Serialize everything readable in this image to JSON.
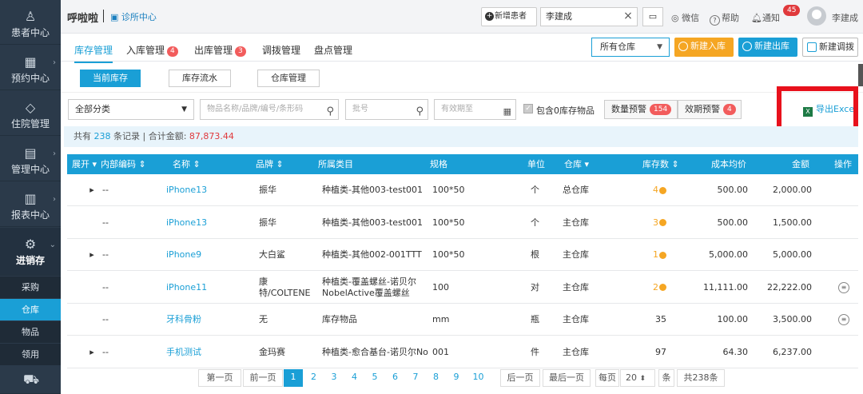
{
  "sidebar": {
    "items": [
      {
        "label": "患者中心",
        "icon": "person-icon"
      },
      {
        "label": "预约中心",
        "icon": "calendar-icon"
      },
      {
        "label": "住院管理",
        "icon": "tag-icon"
      },
      {
        "label": "管理中心",
        "icon": "book-icon"
      },
      {
        "label": "报表中心",
        "icon": "bar-chart-icon"
      },
      {
        "label": "进销存",
        "icon": "gear-icon"
      }
    ],
    "sub_items": [
      "采购",
      "仓库",
      "物品",
      "领用"
    ],
    "selected_sub": "仓库",
    "bottom_icon": "cart-icon"
  },
  "topbar": {
    "app_title": "呼啦啦",
    "clinic_link": "诊所中心",
    "new_patient": "新增患者",
    "patient_value": "李建成",
    "wechat": "微信",
    "help": "帮助",
    "notify": "通知",
    "notify_count": "45",
    "username": "李建成"
  },
  "tabs": [
    {
      "label": "库存管理",
      "badge": ""
    },
    {
      "label": "入库管理",
      "badge": "4"
    },
    {
      "label": "出库管理",
      "badge": "3"
    },
    {
      "label": "调拨管理",
      "badge": ""
    },
    {
      "label": "盘点管理",
      "badge": ""
    }
  ],
  "actions": {
    "warehouse_select": "所有仓库",
    "new_in": "新建入库",
    "new_out": "新建出库",
    "new_transfer": "新建调拨"
  },
  "subtabs": [
    "当前库存",
    "库存流水",
    "仓库管理"
  ],
  "filters": {
    "category": "全部分类",
    "search_placeholder": "物品名称/品牌/编号/条形码",
    "batch_placeholder": "批号",
    "expiry_placeholder": "有效期至",
    "include_zero": "包含0库存物品",
    "qty_warning": "数量预警",
    "qty_warning_count": "154",
    "expiry_warning": "效期预警",
    "expiry_warning_count": "4",
    "export": "导出Exce"
  },
  "summary": {
    "prefix": "共有",
    "count": "238",
    "mid": "条记录 | 合计金额:",
    "total": "87,873.44"
  },
  "table": {
    "headers": [
      "展开",
      "内部编码",
      "名称",
      "品牌",
      "所属类目",
      "规格",
      "单位",
      "仓库",
      "库存数",
      "成本均价",
      "金额",
      "操作"
    ],
    "rows": [
      {
        "expand": "▸",
        "code": "--",
        "name": "iPhone13",
        "brand": "振华",
        "category": "种植类-其他003-test001",
        "spec": "100*50",
        "unit": "个",
        "warehouse": "总仓库",
        "stock": "4",
        "stock_warn": true,
        "cost": "500.00",
        "amount": "2,000.00",
        "op": ""
      },
      {
        "expand": "",
        "code": "--",
        "name": "iPhone13",
        "brand": "振华",
        "category": "种植类-其他003-test001",
        "spec": "100*50",
        "unit": "个",
        "warehouse": "主仓库",
        "stock": "3",
        "stock_warn": true,
        "cost": "500.00",
        "amount": "1,500.00",
        "op": ""
      },
      {
        "expand": "▸",
        "code": "--",
        "name": "iPhone9",
        "brand": "大白鲨",
        "category": "种植类-其他002-001TTT",
        "spec": "100*50",
        "unit": "根",
        "warehouse": "主仓库",
        "stock": "1",
        "stock_warn": true,
        "cost": "5,000.00",
        "amount": "5,000.00",
        "op": ""
      },
      {
        "expand": "",
        "code": "--",
        "name": "iPhone11",
        "brand": "康特/COLTENE",
        "category": "种植类-覆盖螺丝-诺贝尔NobelActive覆盖螺丝",
        "spec": "100",
        "unit": "对",
        "warehouse": "主仓库",
        "stock": "2",
        "stock_warn": true,
        "cost": "11,111.00",
        "amount": "22,222.00",
        "op": "edit"
      },
      {
        "expand": "",
        "code": "--",
        "name": "牙科骨粉",
        "brand": "无",
        "category": "库存物品",
        "spec": "mm",
        "unit": "瓶",
        "warehouse": "主仓库",
        "stock": "35",
        "stock_warn": false,
        "cost": "100.00",
        "amount": "3,500.00",
        "op": "edit"
      },
      {
        "expand": "▸",
        "code": "--",
        "name": "手机测试",
        "brand": "金玛赛",
        "category": "种植类-愈合基台-诺贝尔No",
        "spec": "001",
        "unit": "件",
        "warehouse": "主仓库",
        "stock": "97",
        "stock_warn": false,
        "cost": "64.30",
        "amount": "6,237.00",
        "op": ""
      }
    ]
  },
  "pagination": {
    "first": "第一页",
    "prev": "前一页",
    "pages": [
      "1",
      "2",
      "3",
      "4",
      "5",
      "6",
      "7",
      "8",
      "9",
      "10"
    ],
    "current": "1",
    "next": "后一页",
    "last": "最后一页",
    "per_page_label": "每页",
    "per_page": "20",
    "unit": "条",
    "total": "共238条"
  },
  "colors": {
    "accent": "#1a9fd6",
    "sidebar": "#2b3a4a",
    "warning": "#f5a623",
    "danger": "#e0393c",
    "highlight_box": "#e8111c"
  }
}
